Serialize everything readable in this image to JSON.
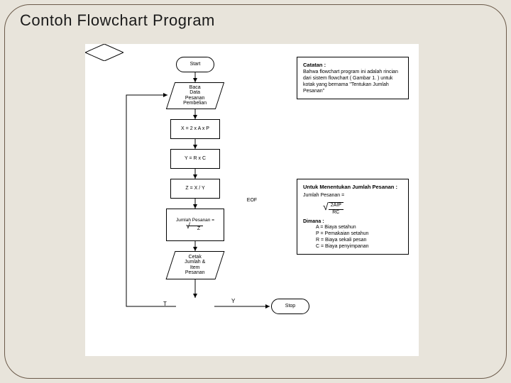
{
  "title": "Contoh Flowchart Program",
  "flow": {
    "start": "Start",
    "read": "Baca\nData\nPesanan\nPembelian",
    "p1": "X = 2 x A x P",
    "p2": "Y = R x C",
    "p3": "Z = X / Y",
    "jp_label": "Jumlah Pesanan =",
    "jp_root": "Z",
    "print": "Cetak\nJumlah &\nItem\nPesanan",
    "decision": "EOF",
    "d_true": "T",
    "d_yes": "Y",
    "stop": "Stop"
  },
  "note1": {
    "title": "Catatan :",
    "body": "Bahwa flowchart program ini adalah rincian dari sistem flowchart ( Gambar 1. ) untuk kotak yang bernama \"Tentukan Jumlah Pesanan\""
  },
  "note2": {
    "title": "Untuk Menentukan Jumlah Pesanan :",
    "jp": "Jumlah Pesanan =",
    "frac_num": "2AIP",
    "frac_den": "RC",
    "dimana": "Dimana :",
    "a": "A = Biaya setahun",
    "p": "P = Pemakaian setahun",
    "r": "R = Biaya sekali pesan",
    "c": "C = Biaya penyimpanan"
  }
}
